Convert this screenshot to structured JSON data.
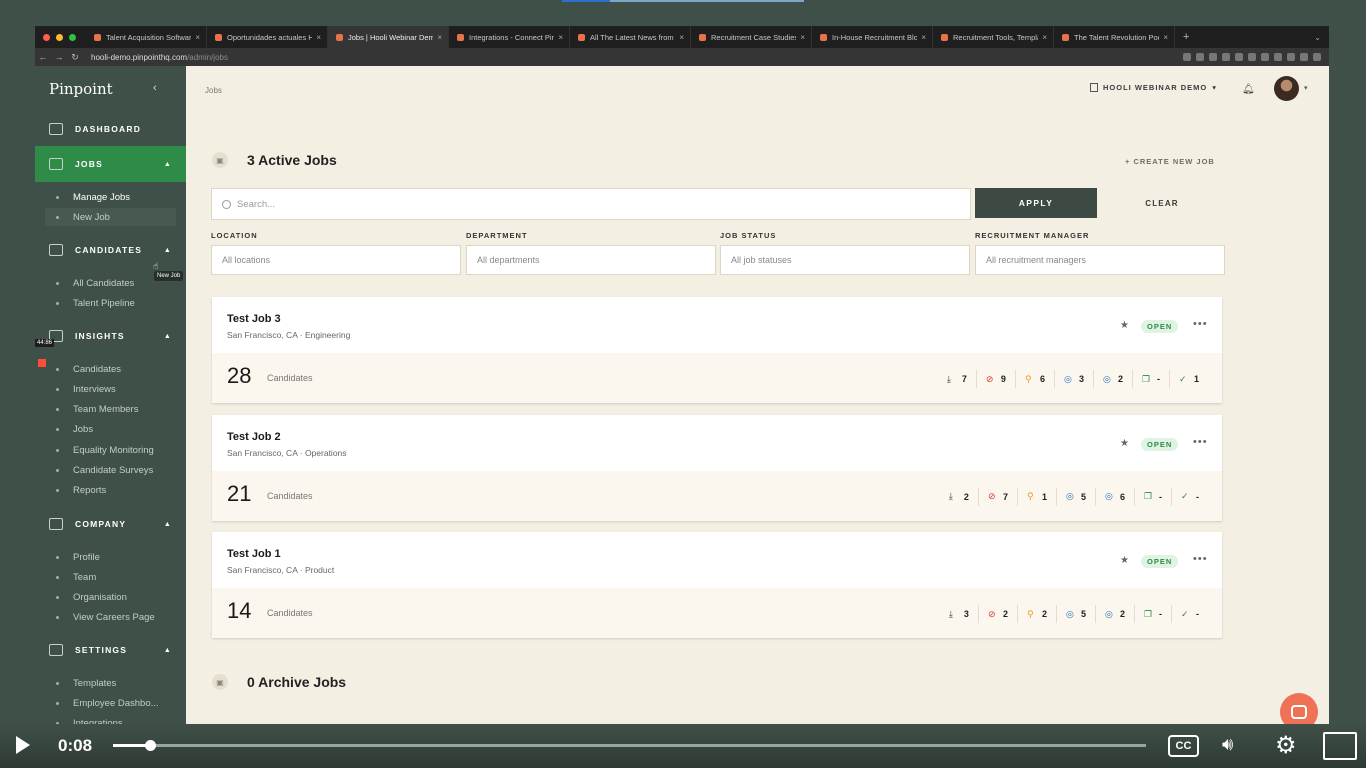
{
  "browser": {
    "tabs": [
      {
        "title": "Talent Acquisition Software - A"
      },
      {
        "title": "Oportunidades actuales Hooli"
      },
      {
        "title": "Jobs | Hooli Webinar Demo Ca",
        "active": true
      },
      {
        "title": "Integrations - Connect Pinpoin"
      },
      {
        "title": "All The Latest News from Pinp"
      },
      {
        "title": "Recruitment Case Studies - Le"
      },
      {
        "title": "In-House Recruitment Blog - I"
      },
      {
        "title": "Recruitment Tools, Templates"
      },
      {
        "title": "The Talent Revolution Podcast"
      }
    ],
    "url_host": "hooli-demo.pinpointhq.com",
    "url_path": "/admin/jobs",
    "new_tab": "+"
  },
  "sidebar": {
    "logo": "Pinpoint",
    "sections": {
      "dashboard": "DASHBOARD",
      "jobs": "JOBS",
      "candidates": "CANDIDATES",
      "insights": "INSIGHTS",
      "company": "COMPANY",
      "settings": "SETTINGS"
    },
    "jobs_items": [
      "Manage Jobs",
      "New Job"
    ],
    "candidates_items": [
      "All Candidates",
      "Talent Pipeline"
    ],
    "insights_items": [
      "Candidates",
      "Interviews",
      "Team Members",
      "Jobs",
      "Equality Monitoring",
      "Candidate Surveys",
      "Reports"
    ],
    "company_items": [
      "Profile",
      "Team",
      "Organisation",
      "View Careers Page"
    ],
    "settings_items": [
      "Templates",
      "Employee Dashbo...",
      "Integrations"
    ],
    "tooltip": "New Job",
    "timer": "44:86"
  },
  "header": {
    "breadcrumb": "Jobs",
    "org_name": "HOOLI WEBINAR DEMO"
  },
  "jobs": {
    "active_title": "3 Active Jobs",
    "archive_title": "0 Archive Jobs",
    "create_label": "+ CREATE NEW JOB",
    "search_placeholder": "Search...",
    "apply_label": "APPLY",
    "clear_label": "CLEAR",
    "filters": [
      {
        "label": "LOCATION",
        "value": "All locations"
      },
      {
        "label": "DEPARTMENT",
        "value": "All departments"
      },
      {
        "label": "JOB STATUS",
        "value": "All job statuses"
      },
      {
        "label": "RECRUITMENT MANAGER",
        "value": "All recruitment managers"
      }
    ],
    "candidates_label": "Candidates",
    "list": [
      {
        "title": "Test Job 3",
        "location": "San Francisco, CA · Engineering",
        "status": "OPEN",
        "count": "28",
        "stages": [
          "7",
          "9",
          "6",
          "3",
          "2",
          "-",
          "1"
        ]
      },
      {
        "title": "Test Job 2",
        "location": "San Francisco, CA · Operations",
        "status": "OPEN",
        "count": "21",
        "stages": [
          "2",
          "7",
          "1",
          "5",
          "6",
          "-",
          "-"
        ]
      },
      {
        "title": "Test Job 1",
        "location": "San Francisco, CA · Product",
        "status": "OPEN",
        "count": "14",
        "stages": [
          "3",
          "2",
          "2",
          "5",
          "2",
          "-",
          "-"
        ]
      }
    ],
    "stage_icons": [
      "inbox-icon",
      "rejected-icon",
      "review-icon",
      "interview-icon",
      "interview-2-icon",
      "offer-icon",
      "hired-icon"
    ],
    "stage_colors": [
      "#333333",
      "#d63b2f",
      "#e79b1c",
      "#2a6fb8",
      "#2a6fb8",
      "#2e8b48",
      "#2e8b48"
    ]
  },
  "player": {
    "time": "0:08",
    "progress": 0.036,
    "cc": "CC"
  }
}
